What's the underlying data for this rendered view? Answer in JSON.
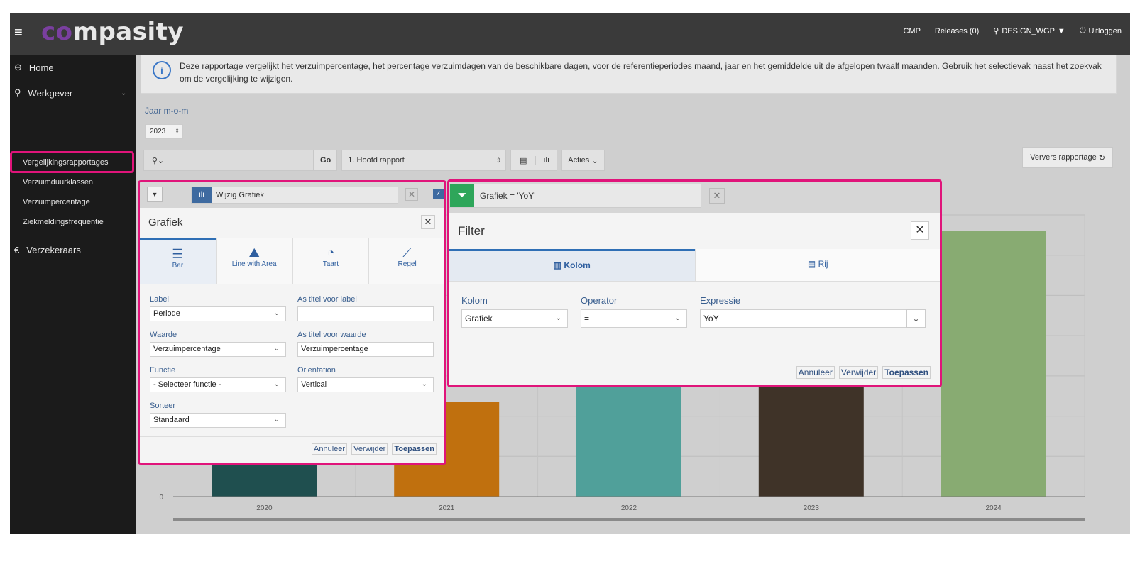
{
  "topbar": {
    "logo_prefix": "co",
    "logo_rest": "mpasity",
    "nav": [
      "CMP",
      "Releases (0)",
      "DESIGN_WGP",
      "Uitloggen"
    ]
  },
  "sidebar": {
    "home": "Home",
    "werkgever": "Werkgever",
    "items": [
      "Vergelijkingsrapportages",
      "Verzuimduurklassen",
      "Verzuimpercentage",
      "Ziekmeldingsfrequentie"
    ],
    "verzekeraars": "Verzekeraars"
  },
  "info": {
    "text": "Deze rapportage vergelijkt het verzuimpercentage, het percentage verzuimdagen van de beschikbare dagen, voor de referentieperiodes maand, jaar en het gemiddelde uit de afgelopen twaalf maanden. Gebruik het selectievak naast het zoekvak om de vergelijking te wijzigen."
  },
  "filters": {
    "jaar_label": "Jaar m-o-m",
    "jaar_value": "2023"
  },
  "toolbar": {
    "go": "Go",
    "report": "1. Hoofd rapport",
    "acties": "Acties",
    "refresh": "Ververs rapportage"
  },
  "chart_data": {
    "type": "bar",
    "categories": [
      "2020",
      "2021",
      "2022",
      "2023",
      "2024"
    ],
    "values": [
      null,
      null,
      null,
      null,
      null
    ],
    "colors": [
      "#1f4f4f",
      "#c0700e",
      "#50a09a",
      "#3f3328",
      "#88ab72"
    ],
    "y_tick_visible": "0"
  },
  "graph": {
    "header_label": "Wijzig Grafiek",
    "title": "Grafiek",
    "tabs": [
      "Bar",
      "Line with Area",
      "Taart",
      "Regel"
    ],
    "label_lbl": "Label",
    "label_val": "Periode",
    "as_label_lbl": "As titel voor label",
    "as_label_val": "",
    "waarde_lbl": "Waarde",
    "waarde_val": "Verzuimpercentage",
    "as_waarde_lbl": "As titel voor waarde",
    "as_waarde_val": "Verzuimpercentage",
    "functie_lbl": "Functie",
    "functie_val": "- Selecteer functie -",
    "orient_lbl": "Orientation",
    "orient_val": "Vertical",
    "sorteer_lbl": "Sorteer",
    "sorteer_val": "Standaard",
    "annuleer": "Annuleer",
    "verwijder": "Verwijder",
    "toepassen": "Toepassen"
  },
  "filter": {
    "header_label": "Grafiek = 'YoY'",
    "title": "Filter",
    "tab_kolom": "Kolom",
    "tab_rij": "Rij",
    "kolom_lbl": "Kolom",
    "kolom_val": "Grafiek",
    "operator_lbl": "Operator",
    "operator_val": "=",
    "expressie_lbl": "Expressie",
    "expressie_val": "YoY",
    "annuleer": "Annuleer",
    "verwijder": "Verwijder",
    "toepassen": "Toepassen"
  }
}
